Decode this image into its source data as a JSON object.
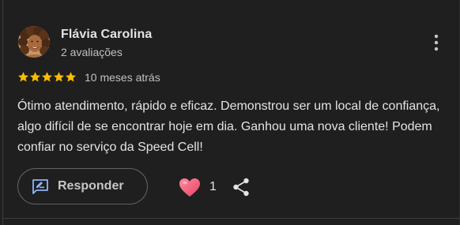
{
  "review": {
    "author": {
      "name": "Flávia Carolina",
      "review_count": "2 avaliações",
      "avatar_icon": "user-avatar-photo"
    },
    "more_options_icon": "more-vert-icon",
    "rating": 5,
    "rating_max": 5,
    "star_color": "#fbbc04",
    "date": "10 meses atrás",
    "text": "Ótimo atendimento, rápido e eficaz. Demonstrou ser um local de confiança, algo difícil de se encontrar hoje em dia. Ganhou uma nova cliente! Podem confiar no serviço da Speed Cell!",
    "actions": {
      "reply_label": "Responder",
      "reply_icon": "rate-review-icon",
      "like_icon": "heart-icon",
      "like_count": "1",
      "share_icon": "share-icon"
    }
  },
  "colors": {
    "background": "#1f1f1f",
    "accent_blue": "#8ab4f8",
    "heart": "#f06292"
  }
}
